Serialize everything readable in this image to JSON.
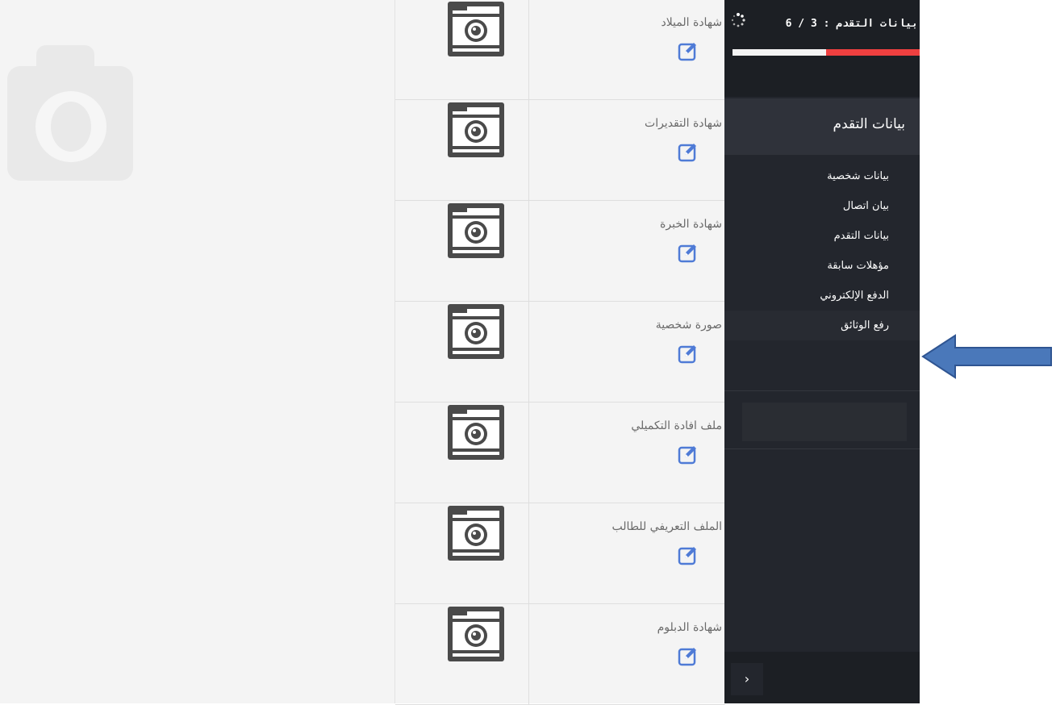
{
  "sidebar": {
    "progress": {
      "text": "بيانات التقدم : 3 / 6",
      "fraction": 0.5,
      "track_color": "#ef4040",
      "fill_color": "#f4f4f4"
    },
    "section_title": "بيانات التقدم",
    "menu": [
      {
        "label": "بيانات شخصية"
      },
      {
        "label": "بيان اتصال"
      },
      {
        "label": "بيانات التقدم"
      },
      {
        "label": "مؤهلات سابقة"
      },
      {
        "label": "الدفع الإلكتروني"
      },
      {
        "label": "رفع الوثائق",
        "active": true
      }
    ],
    "collapse_symbol": "›"
  },
  "documents": [
    {
      "label": "شهادة الميلاد"
    },
    {
      "label": "شهادة التقديرات"
    },
    {
      "label": "شهادة الخبرة"
    },
    {
      "label": "صورة شخصية"
    },
    {
      "label": "ملف افادة التكميلي"
    },
    {
      "label": "الملف التعريفي للطالب"
    },
    {
      "label": "شهادة الدبلوم"
    }
  ],
  "icons": {
    "thumbnail": "camera-icon",
    "edit": "edit-icon",
    "spinner": "spinner-icon",
    "annotation": "left-arrow-icon"
  },
  "colors": {
    "accent_blue": "#4f7bd6",
    "arrow_blue": "#4a78ba",
    "sidebar_bg": "#23262d"
  }
}
